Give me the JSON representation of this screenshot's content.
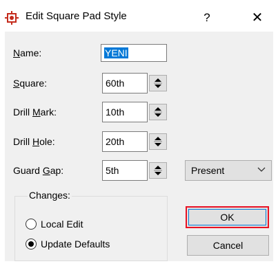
{
  "window": {
    "title": "Edit Square Pad Style",
    "help_glyph": "?",
    "close_glyph": "✕",
    "icon": "pad-icon"
  },
  "fields": {
    "name": {
      "label_pre": "",
      "label_u": "N",
      "label_post": "ame:",
      "value": "YENI"
    },
    "square": {
      "label_pre": "",
      "label_u": "S",
      "label_post": "quare:",
      "value": "60th"
    },
    "drill_mark": {
      "label_pre": "Drill ",
      "label_u": "M",
      "label_post": "ark:",
      "value": "10th"
    },
    "drill_hole": {
      "label_pre": "Drill ",
      "label_u": "H",
      "label_post": "ole:",
      "value": "20th"
    },
    "guard_gap": {
      "label_pre": "Guard ",
      "label_u": "G",
      "label_post": "ap:",
      "value": "5th"
    }
  },
  "present_select": {
    "value": "Present"
  },
  "changes": {
    "label": "Changes:",
    "options": [
      {
        "label": "Local Edit",
        "selected": false
      },
      {
        "label": "Update Defaults",
        "selected": true
      }
    ]
  },
  "buttons": {
    "ok": "OK",
    "cancel": "Cancel"
  },
  "colors": {
    "dialog_bg": "#f0f0f0",
    "selection": "#0078d7",
    "ok_highlight": "#e81123",
    "icon_red": "#c42b1c"
  }
}
